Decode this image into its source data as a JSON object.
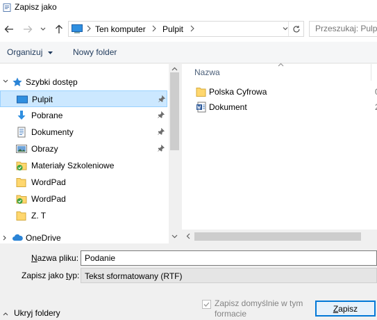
{
  "window": {
    "title": "Zapisz jako"
  },
  "navigation": {
    "breadcrumbs": [
      "Ten komputer",
      "Pulpit"
    ],
    "search_placeholder": "Przeszukaj: Pulpit"
  },
  "commandbar": {
    "organize_label": "Organizuj",
    "new_folder_label": "Nowy folder"
  },
  "navpane": {
    "quick_access_label": "Szybki dostęp",
    "items": [
      {
        "label": "Pulpit",
        "icon": "desktop-folder-icon",
        "pinned": true,
        "selected": true
      },
      {
        "label": "Pobrane",
        "icon": "download-arrow-icon",
        "pinned": true,
        "selected": false
      },
      {
        "label": "Dokumenty",
        "icon": "documents-folder-icon",
        "pinned": true,
        "selected": false
      },
      {
        "label": "Obrazy",
        "icon": "pictures-folder-icon",
        "pinned": true,
        "selected": false
      },
      {
        "label": "Materiały Szkoleniowe",
        "icon": "synced-folder-icon",
        "pinned": false,
        "selected": false
      },
      {
        "label": "WordPad",
        "icon": "folder-icon",
        "pinned": false,
        "selected": false
      },
      {
        "label": "WordPad",
        "icon": "synced-folder-icon",
        "pinned": false,
        "selected": false
      },
      {
        "label": "Z. T",
        "icon": "folder-icon",
        "pinned": false,
        "selected": false
      }
    ],
    "onedrive_label": "OneDrive"
  },
  "filepane": {
    "column_name": "Nazwa",
    "files": [
      {
        "label": "Polska Cyfrowa",
        "icon": "folder-icon",
        "extra": "0"
      },
      {
        "label": "Dokument",
        "icon": "word-document-icon",
        "extra": "2"
      }
    ]
  },
  "form": {
    "filename_label_prefix": "N",
    "filename_label_rest": "azwa pliku:",
    "filename_value": "Podanie",
    "filetype_label_prefix": "Zapisz jako ",
    "filetype_label_u": "t",
    "filetype_label_rest": "yp:",
    "filetype_value": "Tekst sformatowany (RTF)"
  },
  "footer": {
    "hide_folders_label": "Ukryj foldery",
    "default_format_label": "Zapisz domyślnie w tym formacie",
    "default_format_checked": true,
    "save_label_u": "Z",
    "save_label_rest": "apisz"
  },
  "colors": {
    "selection_bg": "#cce8ff",
    "selection_border": "#99d1ff",
    "accent": "#0078d7",
    "folder_yellow": "#ffd76e"
  }
}
